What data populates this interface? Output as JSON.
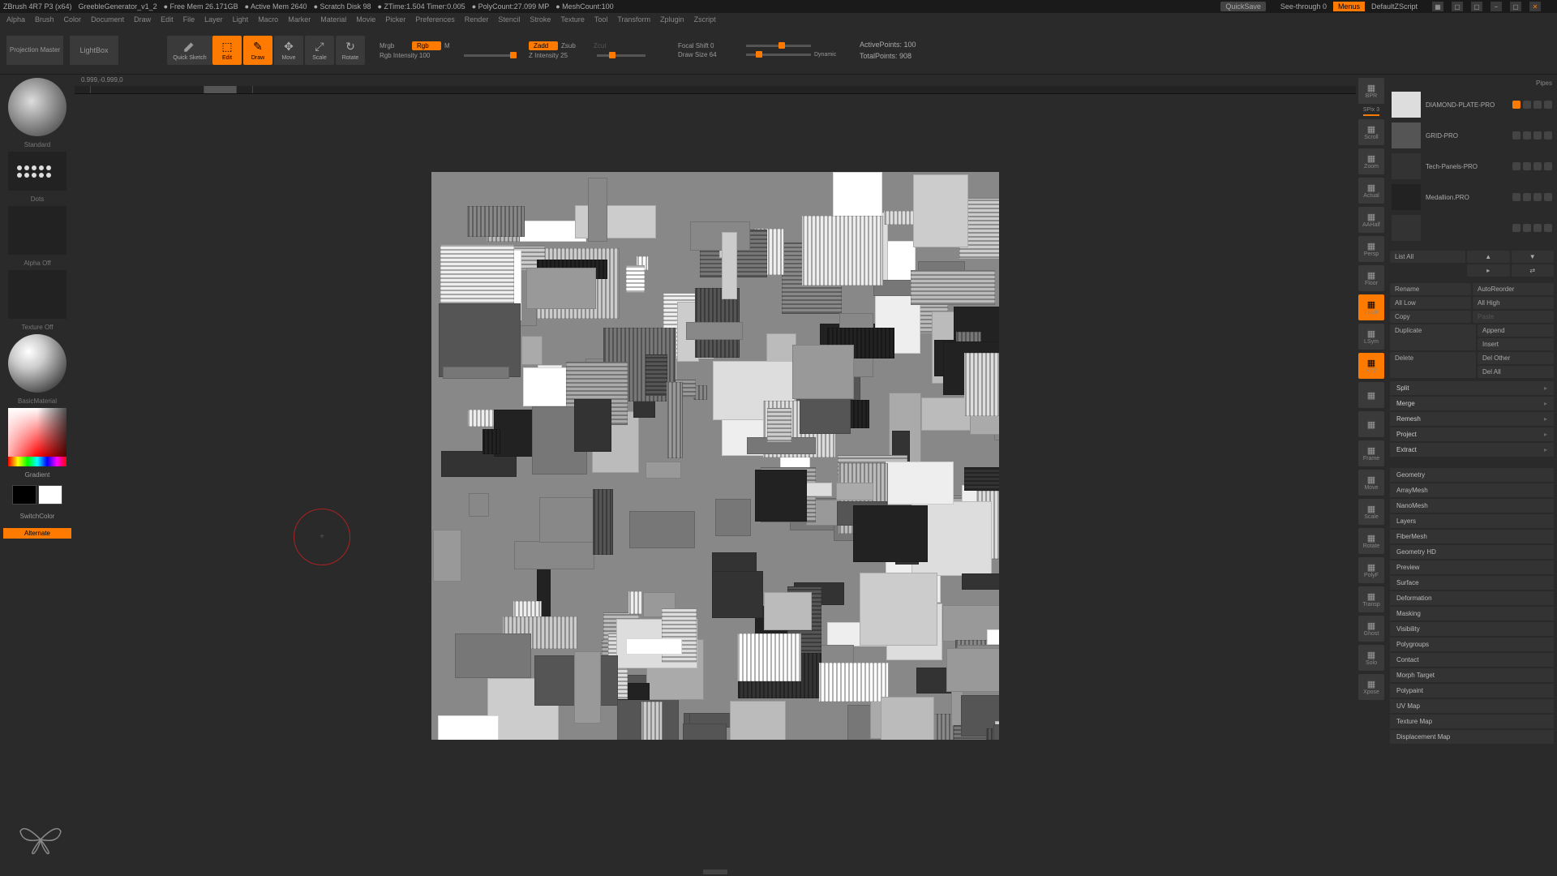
{
  "titlebar": {
    "app": "ZBrush 4R7 P3 (x64)",
    "file": "GreebleGenerator_v1_2",
    "freemem": "● Free Mem 26.171GB",
    "activemem": "● Active Mem 2640",
    "scratch": "● Scratch Disk 98",
    "ztime": "● ZTime:1.504 Timer:0.005",
    "polycount": "● PolyCount:27.099 MP",
    "meshcount": "● MeshCount:100",
    "quicksave": "QuickSave",
    "seethrough": "See-through   0",
    "menus": "Menus",
    "zscript": "DefaultZScript"
  },
  "menubar": {
    "items": [
      "Alpha",
      "Brush",
      "Color",
      "Document",
      "Draw",
      "Edit",
      "File",
      "Layer",
      "Light",
      "Macro",
      "Marker",
      "Material",
      "Movie",
      "Picker",
      "Preferences",
      "Render",
      "Stencil",
      "Stroke",
      "Texture",
      "Tool",
      "Transform",
      "Zplugin",
      "Zscript"
    ]
  },
  "toolbar": {
    "projection": "Projection Master",
    "lightbox": "LightBox",
    "quicksketch": "Quick Sketch",
    "modes": [
      {
        "label": "Edit",
        "active": true
      },
      {
        "label": "Draw",
        "active": true
      },
      {
        "label": "Move",
        "active": false
      },
      {
        "label": "Scale",
        "active": false
      },
      {
        "label": "Rotate",
        "active": false
      }
    ],
    "mrgb": "Mrgb",
    "rgb": "Rgb",
    "m": "M",
    "rgb_intensity": "Rgb Intensity 100",
    "zadd": "Zadd",
    "zsub": "Zsub",
    "zcut": "Zcut",
    "z_intensity": "Z Intensity 25",
    "focal_shift": "Focal Shift 0",
    "draw_size": "Draw Size 64",
    "dynamic": "Dynamic",
    "active_points": "ActivePoints: 100",
    "total_points": "TotalPoints: 908"
  },
  "left": {
    "brush": "Standard",
    "stroke": "Dots",
    "alpha": "Alpha Off",
    "texture": "Texture Off",
    "material": "BasicMaterial",
    "gradient": "Gradient",
    "switchcolor": "SwitchColor",
    "alternate": "Alternate"
  },
  "canvas": {
    "coords": "0.999,-0.999,0"
  },
  "right_toolbar": {
    "items": [
      "BPR",
      "SPix 3",
      "Scroll",
      "Zoom",
      "Actual",
      "AAHalf",
      "Persp",
      "Floor",
      "Local",
      "LSym",
      "XYZ",
      "",
      "",
      "Frame",
      "Move",
      "Scale",
      "Rotate",
      "PolyF",
      "Transp",
      "Ghost",
      "Solo",
      "Xpose"
    ]
  },
  "right_panel": {
    "top_label": "Pipes",
    "tools": [
      {
        "name": "DIAMOND-PLATE-PRO"
      },
      {
        "name": "GRID-PRO"
      },
      {
        "name": "Tech-Panels-PRO"
      },
      {
        "name": "Medallion.PRO"
      },
      {
        "name": ""
      }
    ],
    "listall": "List All",
    "rename": "Rename",
    "autoreorder": "AutoReorder",
    "alllow": "All Low",
    "allhigh": "All High",
    "copy": "Copy",
    "paste": "Paste",
    "duplicate": "Duplicate",
    "append": "Append",
    "insert": "Insert",
    "delete": "Delete",
    "delother": "Del Other",
    "delall": "Del All",
    "dropdowns": [
      "Split",
      "Merge",
      "Remesh",
      "Project",
      "Extract"
    ],
    "sections": [
      "Geometry",
      "ArrayMesh",
      "NanoMesh",
      "Layers",
      "FiberMesh",
      "Geometry HD",
      "Preview",
      "Surface",
      "Deformation",
      "Masking",
      "Visibility",
      "Polygroups",
      "Contact",
      "Morph Target",
      "Polypaint",
      "UV Map",
      "Texture Map",
      "Displacement Map"
    ]
  }
}
